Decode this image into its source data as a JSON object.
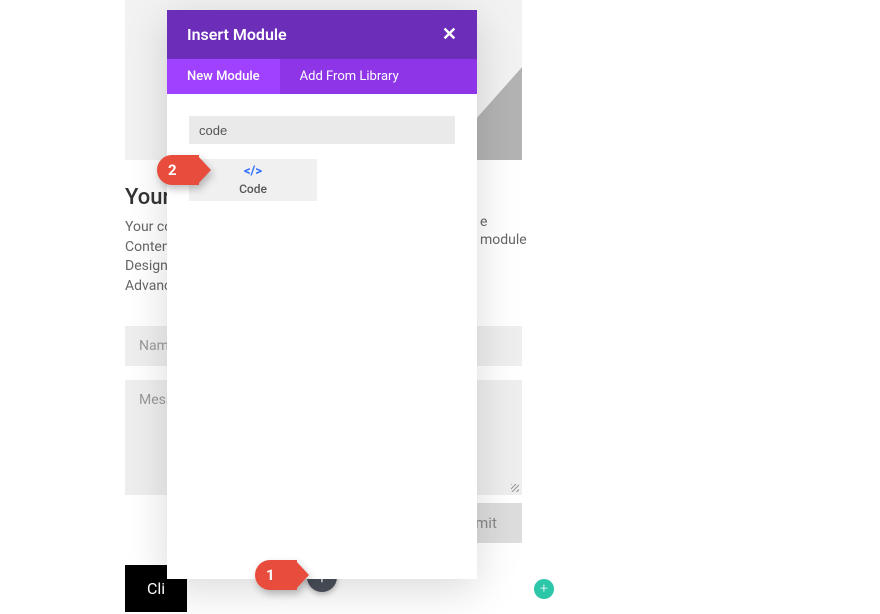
{
  "background": {
    "heading": "Your T",
    "text_lines": [
      "Your co",
      "Content",
      "Design s",
      "Advance"
    ],
    "overflow1": "e",
    "overflow2": "module",
    "name_placeholder": "Name",
    "message_placeholder": "Messa",
    "submit_label": "mit",
    "click_label": "Cli"
  },
  "modal": {
    "title": "Insert Module",
    "tabs": {
      "new_module": "New Module",
      "add_from_library": "Add From Library"
    },
    "search_value": "code",
    "modules": [
      {
        "icon": "</>",
        "label": "Code"
      }
    ]
  },
  "callouts": {
    "one": "1",
    "two": "2"
  },
  "buttons": {
    "add_module": "+",
    "add_section": "+"
  }
}
